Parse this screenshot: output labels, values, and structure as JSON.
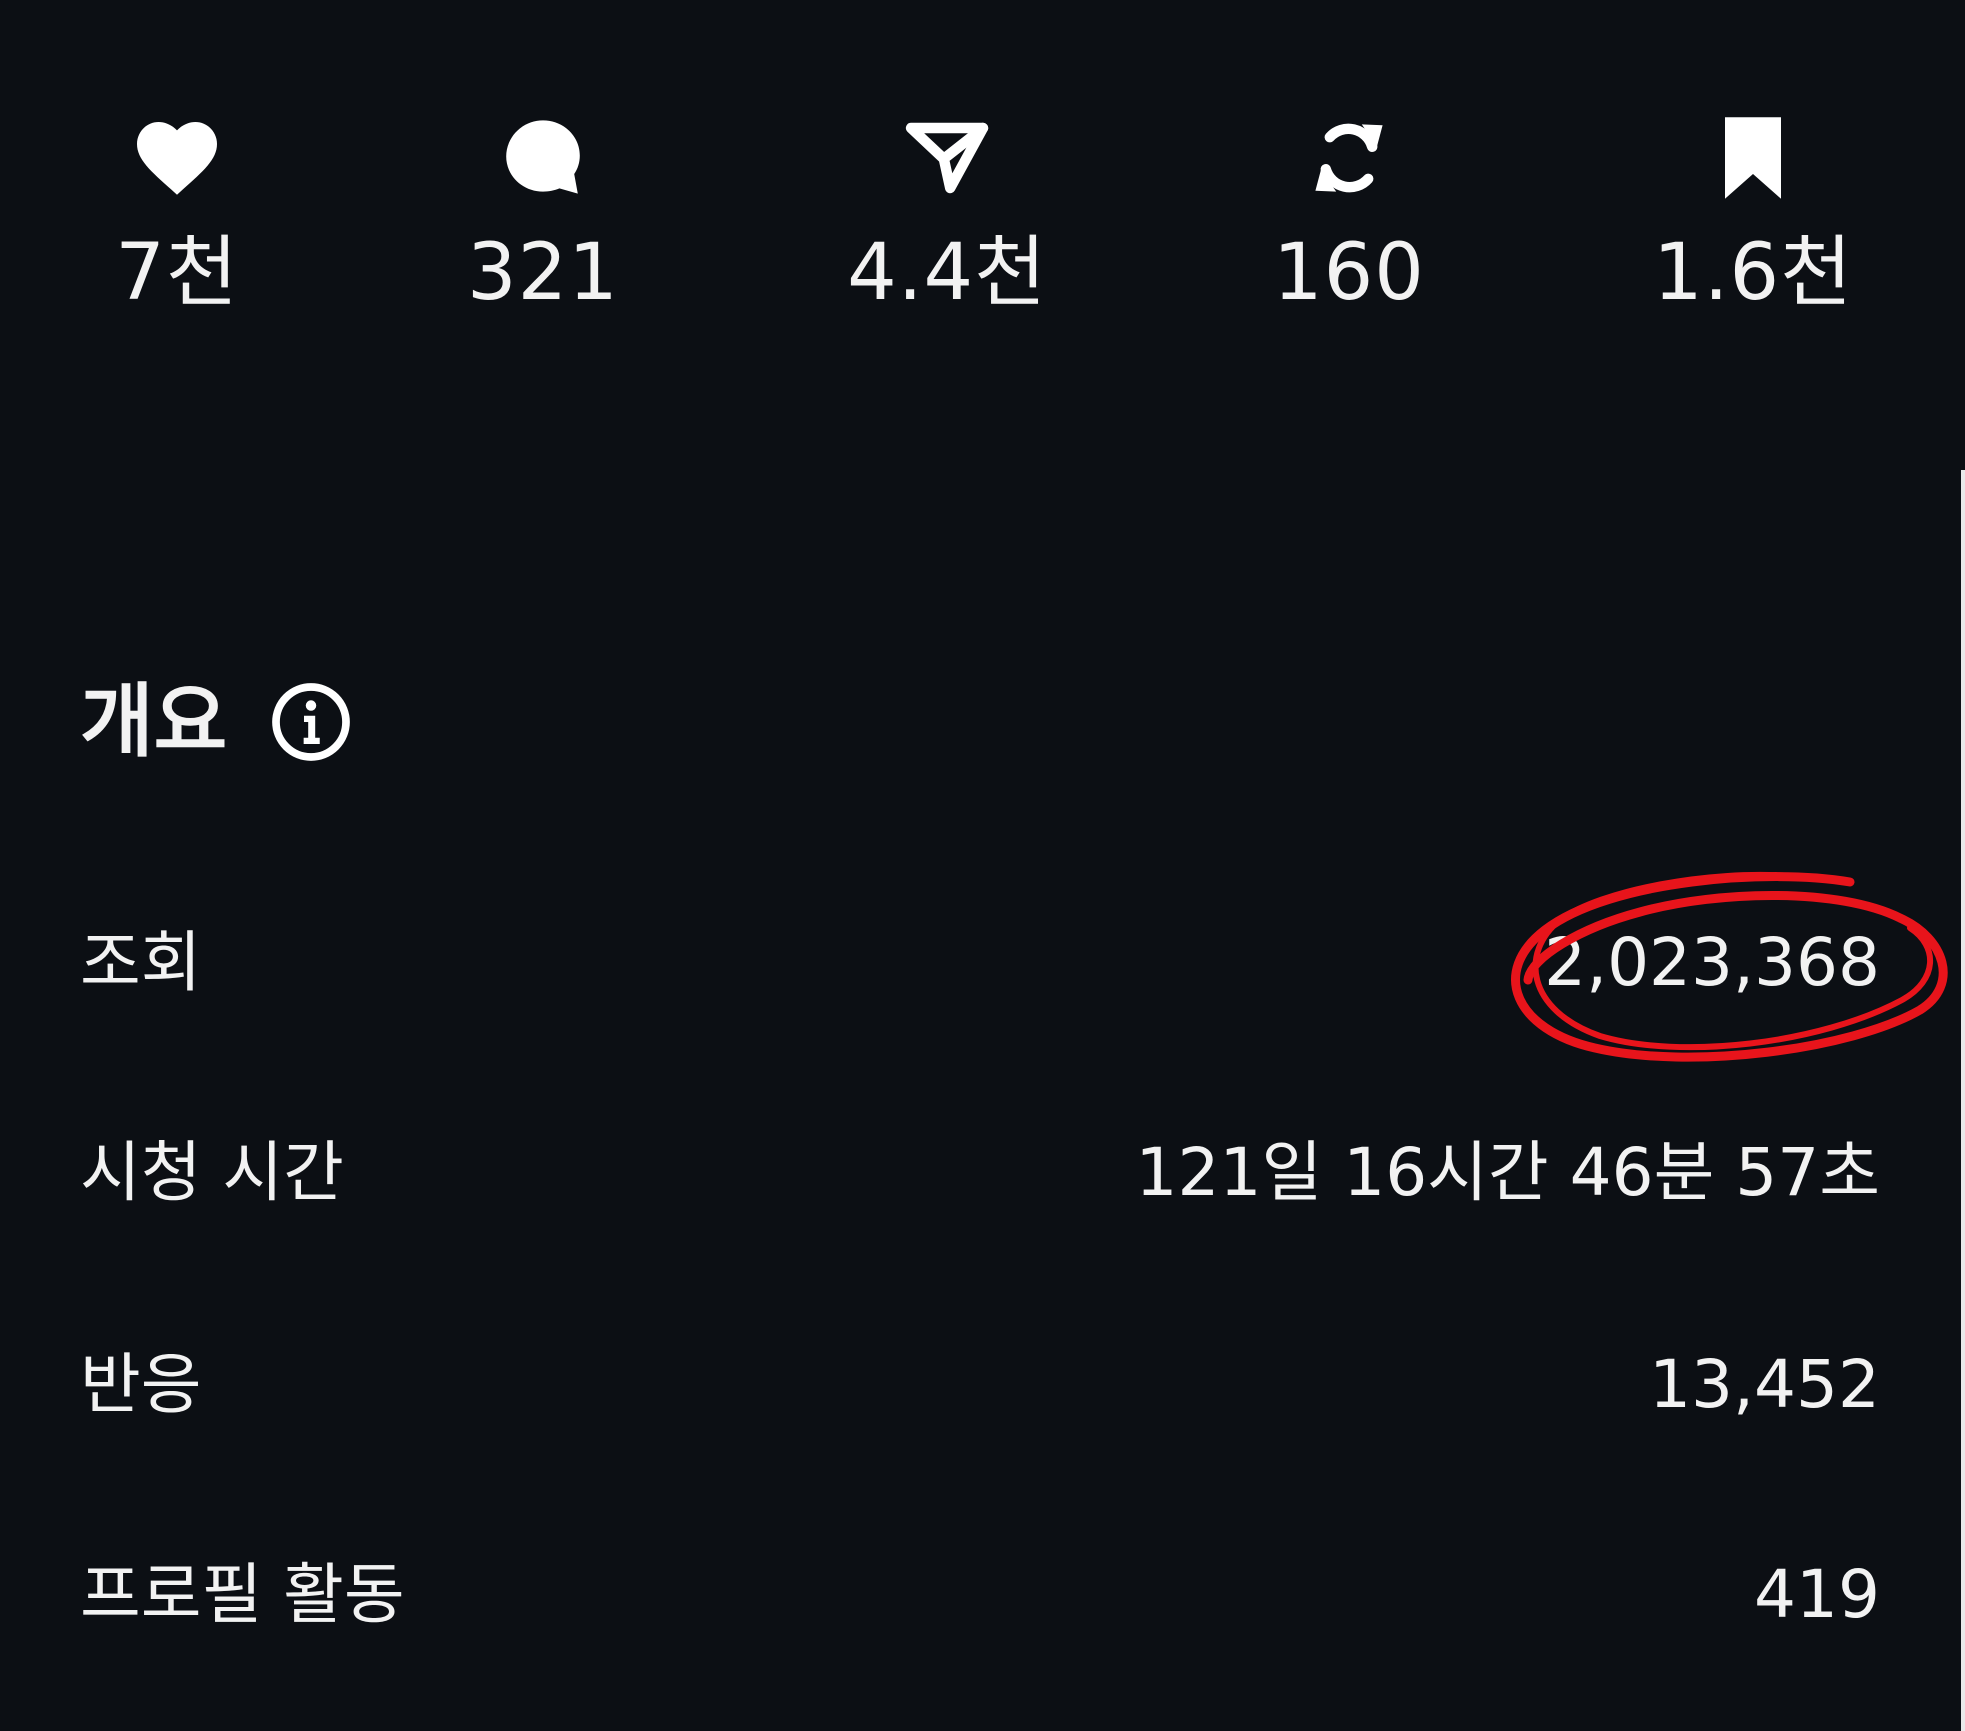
{
  "stats": [
    {
      "icon": "heart-icon",
      "count": "7천"
    },
    {
      "icon": "comment-icon",
      "count": "321"
    },
    {
      "icon": "send-icon",
      "count": "4.4천"
    },
    {
      "icon": "repost-icon",
      "count": "160"
    },
    {
      "icon": "bookmark-icon",
      "count": "1.6천"
    }
  ],
  "overview": {
    "title": "개요",
    "info_icon": "info-icon",
    "rows": [
      {
        "label": "조회",
        "value": "2,023,368"
      },
      {
        "label": "시청 시간",
        "value": "121일 16시간 46분 57초"
      },
      {
        "label": "반응",
        "value": "13,452"
      },
      {
        "label": "프로필 활동",
        "value": "419"
      }
    ]
  },
  "colors": {
    "background": "#0c0f14",
    "text": "#f2f2f2",
    "annotation": "#e8141b"
  }
}
